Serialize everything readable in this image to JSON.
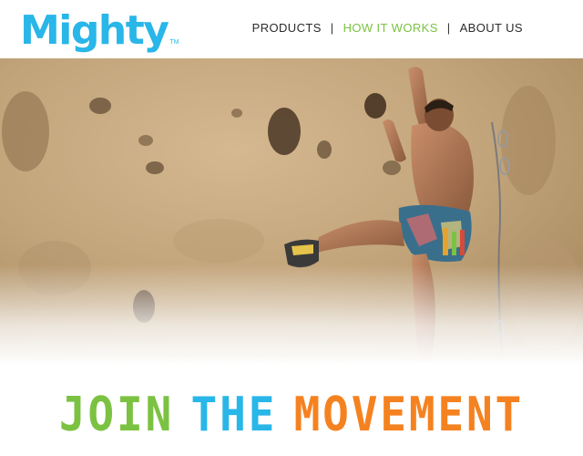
{
  "brand": {
    "name": "Mighty",
    "trademark": "TM",
    "color": "#29b6e8"
  },
  "nav": {
    "items": [
      {
        "label": "PRODUCTS",
        "active": false
      },
      {
        "label": "HOW IT WORKS",
        "active": true
      },
      {
        "label": "ABOUT US",
        "active": false
      }
    ],
    "separator": "|",
    "text_color": "#2b2b2b",
    "active_color": "#7cc242"
  },
  "hero": {
    "image": "rock-climber-photo"
  },
  "tagline": {
    "words": [
      {
        "text": "JOIN",
        "color": "#7cc242"
      },
      {
        "text": "THE",
        "color": "#29b6e8"
      },
      {
        "text": "MOVEMENT",
        "color": "#f58220"
      }
    ]
  }
}
